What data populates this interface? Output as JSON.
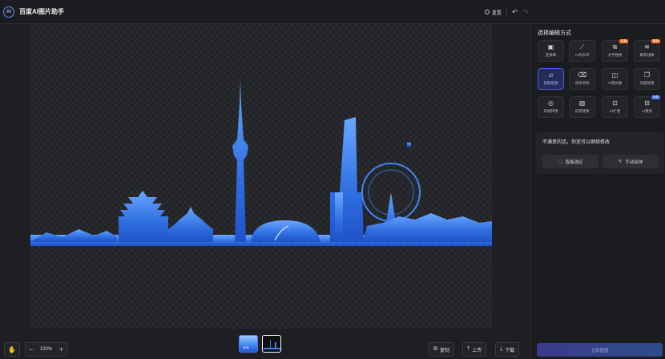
{
  "app": {
    "logo_text": "AI",
    "title": "百度AI图片助手"
  },
  "top": {
    "reset_label": "重置",
    "undo_icon": "undo-icon",
    "redo_icon": "redo-icon"
  },
  "sidebar": {
    "title": "选择编辑方式",
    "tools": [
      {
        "label": "变清晰",
        "icon": "hd-icon",
        "badge": ""
      },
      {
        "label": "AI去水印",
        "icon": "wand-icon",
        "badge": ""
      },
      {
        "label": "文字替换",
        "icon": "text-replace-icon",
        "badge": "付费"
      },
      {
        "label": "最新线稿",
        "icon": "lineart-icon",
        "badge": "新功"
      },
      {
        "label": "智能抠图",
        "icon": "cutout-icon",
        "badge": "",
        "active": true
      },
      {
        "label": "涂抹消除",
        "icon": "eraser-icon",
        "badge": ""
      },
      {
        "label": "AI相似图",
        "icon": "similar-icon",
        "badge": ""
      },
      {
        "label": "局部替换",
        "icon": "partial-replace-icon",
        "badge": ""
      },
      {
        "label": "风格转换",
        "icon": "style-icon",
        "badge": ""
      },
      {
        "label": "背景替换",
        "icon": "background-icon",
        "badge": ""
      },
      {
        "label": "AI扩图",
        "icon": "expand-icon",
        "badge": ""
      },
      {
        "label": "AI重绘",
        "icon": "redraw-icon",
        "badge": "免费"
      }
    ],
    "unsatisfied": {
      "title": "不满意的话，你还可以继续修改",
      "smart_select": "智能选区",
      "manual_paint": "手动涂抹"
    },
    "apply_label": "立即抠图"
  },
  "bottom": {
    "zoom_minus": "−",
    "zoom_value": "100%",
    "zoom_plus": "+",
    "thumb_tag": "原图",
    "copy_label": "复制",
    "upload_label": "上传",
    "download_label": "下载"
  },
  "colors": {
    "accent": "#4a5fd8",
    "skyline_blue": "#3f7fe8",
    "badge_orange": "#ff7a2f"
  }
}
